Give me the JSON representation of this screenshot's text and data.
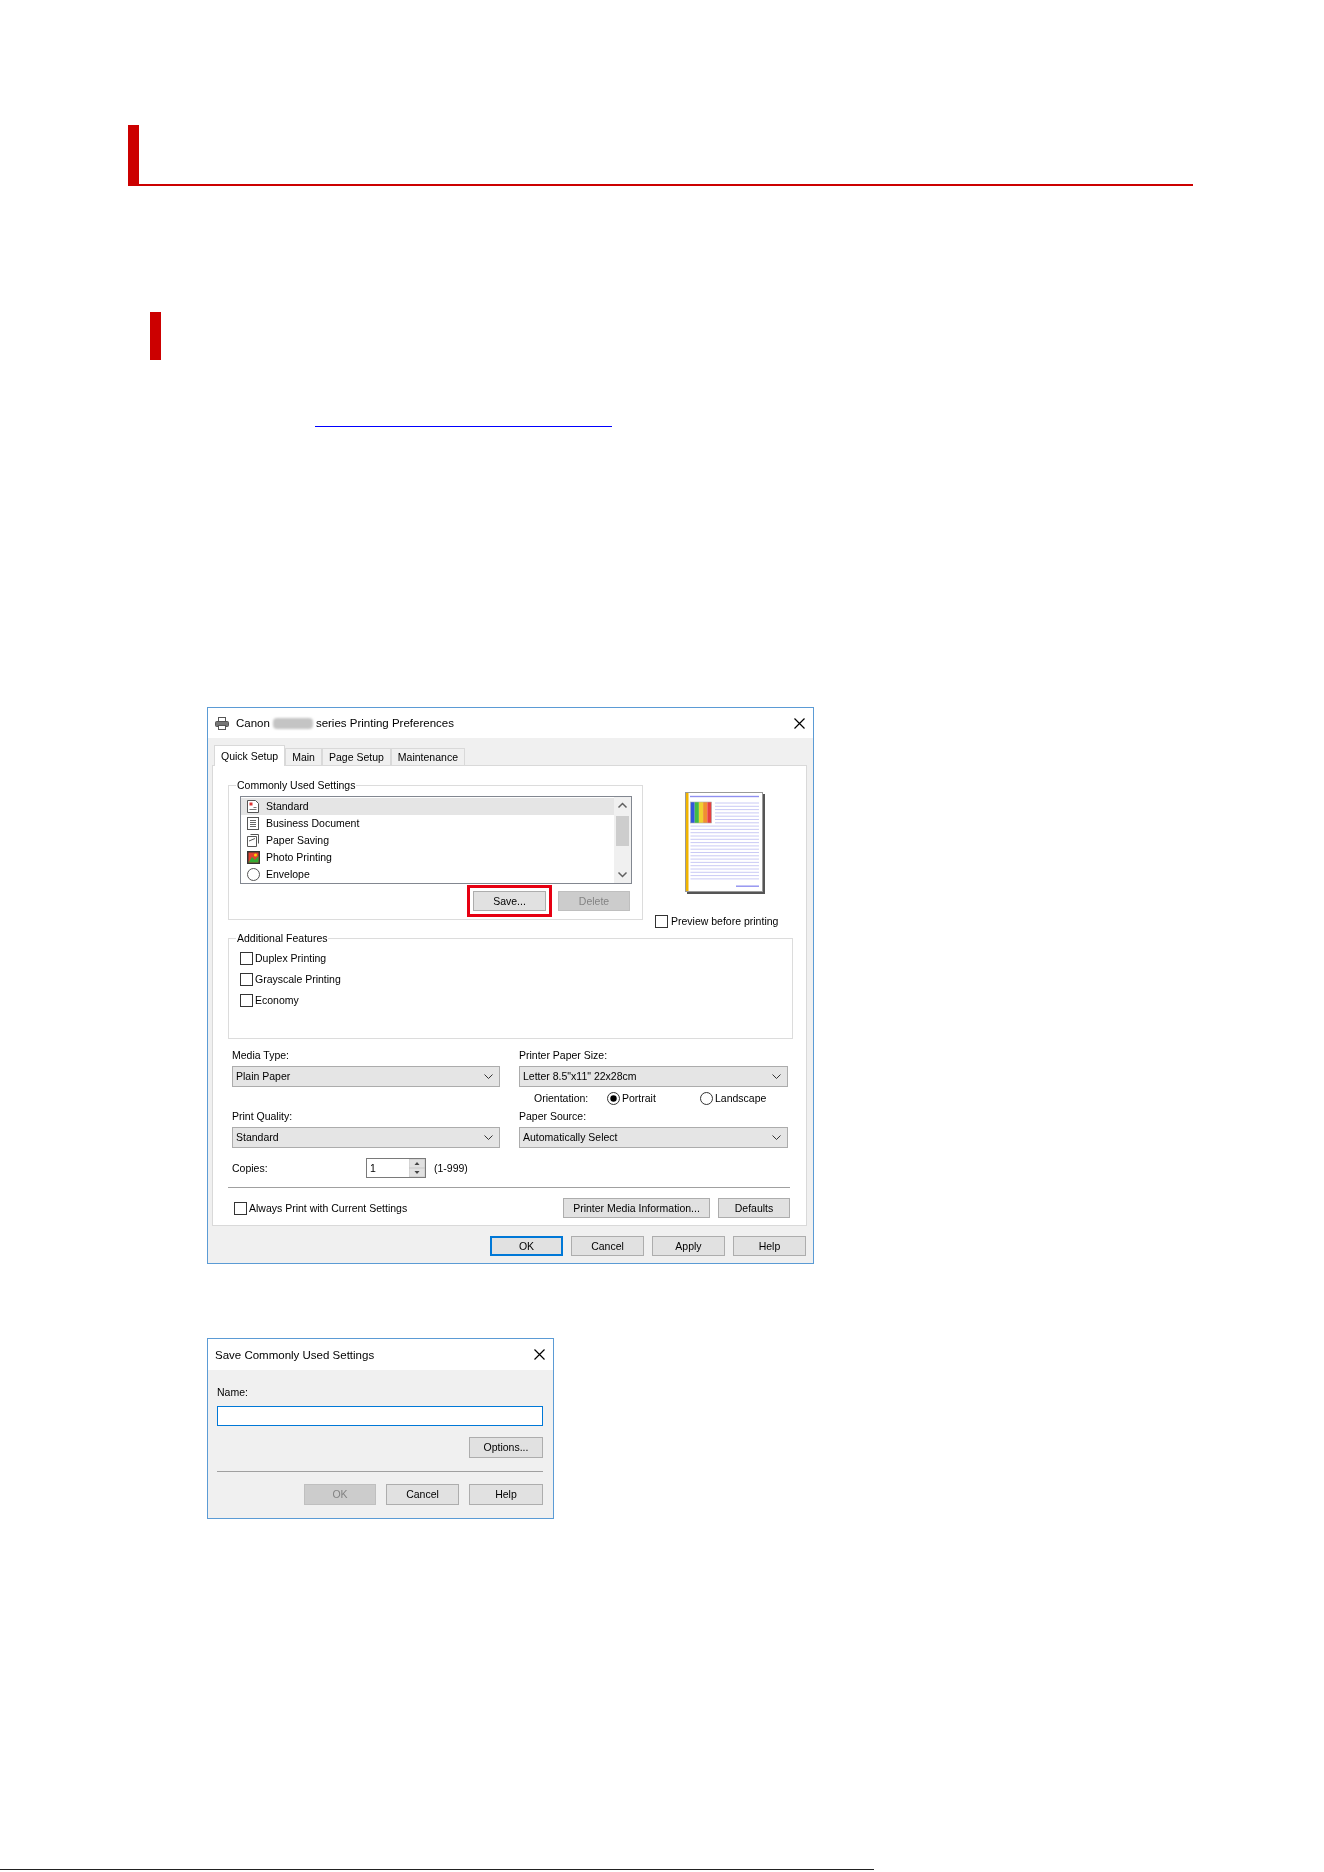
{
  "settings_dialog": {
    "title_start": "Canon",
    "title_end": "series Printing Preferences",
    "tabs": [
      {
        "label": "Quick Setup",
        "selected": true
      },
      {
        "label": "Main",
        "selected": false
      },
      {
        "label": "Page Setup",
        "selected": false
      },
      {
        "label": "Maintenance",
        "selected": false
      }
    ],
    "commonly_used_settings": {
      "label": "Commonly Used Settings",
      "items": [
        {
          "kind": "standard",
          "label": "Standard",
          "selected": true
        },
        {
          "kind": "document",
          "label": "Business Document",
          "selected": false
        },
        {
          "kind": "saving",
          "label": "Paper Saving",
          "selected": false
        },
        {
          "kind": "photo",
          "label": "Photo Printing",
          "selected": false
        },
        {
          "kind": "envelope",
          "label": "Envelope",
          "selected": false
        }
      ],
      "buttons": [
        {
          "label": "Save...",
          "disabled": false,
          "highlighted": true
        },
        {
          "label": "Delete",
          "disabled": true,
          "highlighted": false
        }
      ]
    },
    "preview": {
      "label": "Preview before printing",
      "checked": false
    },
    "additional_features": {
      "label": "Additional Features",
      "options": [
        {
          "label": "Duplex Printing",
          "checked": false
        },
        {
          "label": "Grayscale Printing",
          "checked": false
        },
        {
          "label": "Economy",
          "checked": false
        }
      ]
    },
    "media_type": {
      "label": "Media Type:",
      "value": "Plain Paper"
    },
    "printer_paper_size": {
      "label": "Printer Paper Size:",
      "value": "Letter 8.5\"x11\" 22x28cm"
    },
    "orientation": {
      "label": "Orientation:",
      "options": [
        {
          "label": "Portrait",
          "selected": true
        },
        {
          "label": "Landscape",
          "selected": false
        }
      ]
    },
    "print_quality": {
      "label": "Print Quality:",
      "value": "Standard"
    },
    "paper_source": {
      "label": "Paper Source:",
      "value": "Automatically Select"
    },
    "copies": {
      "label": "Copies:",
      "value": "1",
      "range": "(1-999)"
    },
    "always_print": {
      "label": "Always Print with Current Settings",
      "checked": false
    },
    "panel_buttons": [
      {
        "label": "Printer Media Information..."
      },
      {
        "label": "Defaults"
      }
    ],
    "footer_buttons": [
      {
        "label": "OK",
        "default": true
      },
      {
        "label": "Cancel",
        "default": false
      },
      {
        "label": "Apply",
        "default": false
      },
      {
        "label": "Help",
        "default": false
      }
    ]
  },
  "save_dialog": {
    "title": "Save Commonly Used Settings",
    "name_label": "Name:",
    "name_field": {
      "focused": true
    },
    "options_button": "Options...",
    "buttons": [
      {
        "label": "OK",
        "disabled": true
      },
      {
        "label": "Cancel",
        "disabled": false
      },
      {
        "label": "Help",
        "disabled": false
      }
    ]
  }
}
